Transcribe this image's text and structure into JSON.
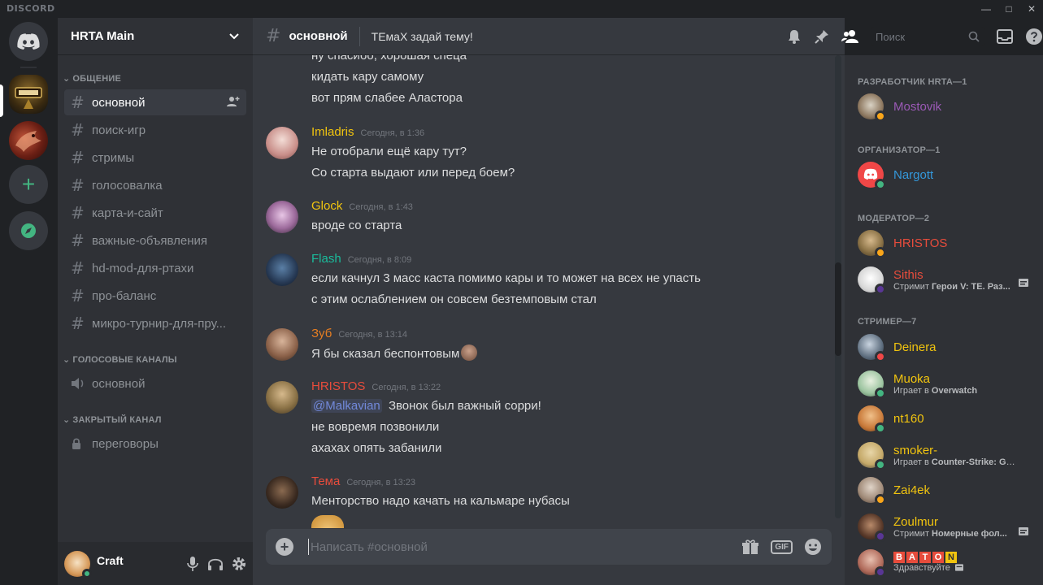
{
  "window": {
    "brand": "DISCORD",
    "controls": [
      "—",
      "□",
      "✕"
    ]
  },
  "colors": {
    "online": "#43b581",
    "idle": "#faa61a",
    "dnd": "#f04747",
    "streaming": "#593695",
    "accent": "#7289da"
  },
  "server": {
    "name": "HRTA Main",
    "categories": [
      {
        "label": "ОБЩЕНИЕ"
      },
      {
        "label": "ГОЛОСОВЫЕ КАНАЛЫ"
      },
      {
        "label": "ЗАКРЫТЫЙ КАНАЛ"
      }
    ],
    "text_channels": [
      "основной",
      "поиск-игр",
      "стримы",
      "голосовалка",
      "карта-и-сайт",
      "важные-объявления",
      "hd-mod-для-ртахи",
      "про-баланс",
      "микро-турнир-для-пру..."
    ],
    "voice_channel": "основной",
    "private_channel": "переговоры"
  },
  "user": {
    "name": "Craft"
  },
  "chat": {
    "channel": "основной",
    "topic": "ТЕмаХ задай тему!",
    "search_placeholder": "Поиск",
    "composer_placeholder": "Написать #основной",
    "gif_label": "GIF",
    "groups": [
      {
        "author": "",
        "time": "",
        "color": "#dcddde",
        "lines": [
          "ну спасибо, хорошая спеца",
          "кидать кару самому",
          "вот прям слабее Аластора"
        ]
      },
      {
        "author": "Imladris",
        "time": "Сегодня, в 1:36",
        "color": "#f1c40f",
        "lines": [
          "Не отобрали ещё кару тут?",
          "Со старта выдают или перед боем?"
        ]
      },
      {
        "author": "Glock",
        "time": "Сегодня, в 1:43",
        "color": "#f1c40f",
        "lines": [
          "вродe со старта"
        ]
      },
      {
        "author": "Flash",
        "time": "Сегодня, в 8:09",
        "color": "#1abc9c",
        "lines": [
          "если качнул 3 масс каста помимо кары и то может на всех не упасть",
          "с этим ослаблением он совсем безтемповым стал"
        ]
      },
      {
        "author": "Зуб",
        "time": "Сегодня, в 13:14",
        "color": "#e67e22",
        "lines": [
          "Я бы сказал беспонтовым"
        ]
      },
      {
        "author": "HRISTOS",
        "time": "Сегодня, в 13:22",
        "color": "#e74c3c",
        "mention": "@Malkavian",
        "lines": [
          "Звонок был важный сорри!",
          "не вовремя позвонили",
          "ахахах опять забанили"
        ]
      },
      {
        "author": "Тема",
        "time": "Сегодня, в 13:23",
        "color": "#e74c3c",
        "lines": [
          "Менторство надо качать на кальмаре нубасы"
        ]
      }
    ]
  },
  "members": {
    "roles": [
      {
        "label": "РАЗРАБОТЧИК HRTA—1"
      },
      {
        "label": "ОРГАНИЗАТОР—1"
      },
      {
        "label": "МОДЕРАТОР—2"
      },
      {
        "label": "СТРИМЕР—7"
      }
    ],
    "list": [
      {
        "name": "Mostovik",
        "color": "#9b59b6",
        "activity": "",
        "status": "idle"
      },
      {
        "name": "Nargott",
        "color": "#3498db",
        "activity": "",
        "status": "online"
      },
      {
        "name": "HRISTOS",
        "color": "#e74c3c",
        "activity": "",
        "status": "idle"
      },
      {
        "name": "Sithis",
        "color": "#e74c3c",
        "activity_prefix": "Стримит ",
        "activity_game": "Герои V: ТЕ. Раз...",
        "status": "streaming"
      },
      {
        "name": "Deinera",
        "color": "#f1c40f",
        "activity": "",
        "status": "dnd"
      },
      {
        "name": "Muoka",
        "color": "#f1c40f",
        "activity_prefix": "Играет в ",
        "activity_game": "Overwatch",
        "status": "online"
      },
      {
        "name": "nt160",
        "color": "#f1c40f",
        "activity": "",
        "status": "online"
      },
      {
        "name": "smoker-",
        "color": "#f1c40f",
        "activity_prefix": "Играет в ",
        "activity_game": "Counter-Strike: Glob...",
        "status": "online"
      },
      {
        "name": "Zai4ek",
        "color": "#f1c40f",
        "activity": "",
        "status": "idle"
      },
      {
        "name": "Zoulmur",
        "color": "#f1c40f",
        "activity_prefix": "Стримит ",
        "activity_game": "Номерные фол...",
        "status": "streaming"
      },
      {
        "name": "BATON",
        "color": "#f1c40f",
        "activity_prefix": "Здравствуйте",
        "activity_game": "",
        "status": "streaming",
        "letters": [
          "B",
          "A",
          "T",
          "O",
          "N"
        ]
      }
    ]
  }
}
